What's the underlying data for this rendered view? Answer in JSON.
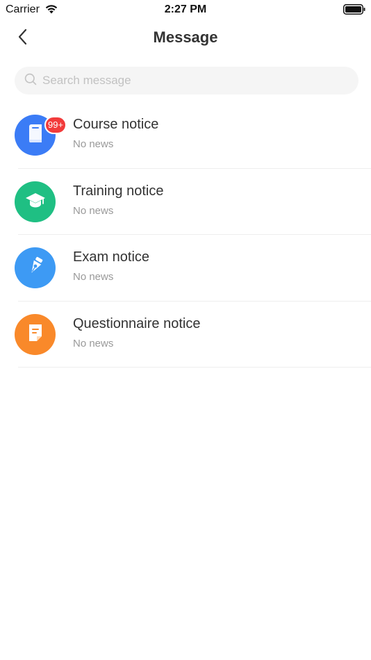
{
  "status_bar": {
    "carrier": "Carrier",
    "time": "2:27 PM"
  },
  "header": {
    "title": "Message",
    "back_icon": "chevron-left-icon"
  },
  "search": {
    "placeholder": "Search message",
    "value": "",
    "icon": "search-icon"
  },
  "notices": [
    {
      "title": "Course notice",
      "subtitle": "No news",
      "badge": "99+",
      "icon": "book-icon",
      "color": "#3b7cf6"
    },
    {
      "title": "Training notice",
      "subtitle": "No news",
      "badge": "",
      "icon": "graduation-cap-icon",
      "color": "#1fbf83"
    },
    {
      "title": "Exam notice",
      "subtitle": "No news",
      "badge": "",
      "icon": "pen-nib-icon",
      "color": "#3d9af4"
    },
    {
      "title": "Questionnaire notice",
      "subtitle": "No news",
      "badge": "",
      "icon": "document-icon",
      "color": "#f9892a"
    }
  ],
  "colors": {
    "badge": "#f23b3b",
    "divider": "#eeeeee",
    "search_bg": "#f5f5f5"
  }
}
